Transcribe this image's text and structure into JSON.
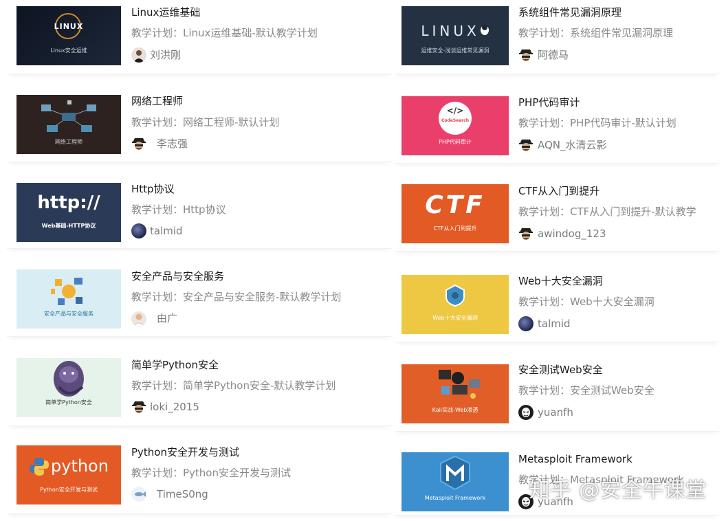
{
  "courses": [
    {
      "title": "Linux运维基础",
      "plan": "教学计划：Linux运维基础-默认教学计划",
      "author": "刘洪刚",
      "thumb_logo": "LINUX",
      "thumb_caption": "Linux安全运维"
    },
    {
      "title": "系统组件常见漏洞原理",
      "plan": "教学计划：系统组件常见漏洞原理",
      "author": "阿德马",
      "thumb_logo": "LINUX",
      "thumb_caption": "运维安全-浅谈运维常见漏洞"
    },
    {
      "title": "网络工程师",
      "plan": "教学计划：网络工程师-默认计划",
      "author": "李志强",
      "thumb_caption": "网络工程师"
    },
    {
      "title": "PHP代码审计",
      "plan": "教学计划：PHP代码审计-默认计划",
      "author": "AQN_水清云影",
      "thumb_logo": "CodeSearch",
      "thumb_caption": "PHP代码审计"
    },
    {
      "title": "Http协议",
      "plan": "教学计划：Http协议",
      "author": "talmid",
      "thumb_logo": "http://",
      "thumb_caption": "Web基础-HTTP协议"
    },
    {
      "title": "CTF从入门到提升",
      "plan": "教学计划：CTF从入门到提升-默认教学",
      "author": "awindog_123",
      "thumb_logo": "CTF",
      "thumb_caption": "CTF从入门到提升"
    },
    {
      "title": "安全产品与安全服务",
      "plan": "教学计划：安全产品与安全服务-默认教学计划",
      "author": "由广",
      "thumb_caption": "安全产品与安全服务"
    },
    {
      "title": "Web十大安全漏洞",
      "plan": "教学计划：Web十大安全漏洞",
      "author": "talmid",
      "thumb_caption": "Web十大安全漏洞"
    },
    {
      "title": "简单学Python安全",
      "plan": "教学计划：简单学Python安全-默认教学计划",
      "author": "loki_2015",
      "thumb_caption": "简单学Python安全"
    },
    {
      "title": "安全测试Web安全",
      "plan": "教学计划：安全测试Web安全",
      "author": "yuanfh",
      "thumb_caption": "Kali实战-Web渗透"
    },
    {
      "title": "Python安全开发与测试",
      "plan": "教学计划：Python安全开发与测试",
      "author": "TimeS0ng",
      "thumb_logo": "python",
      "thumb_caption": "Python安全开发与测试"
    },
    {
      "title": "Metasploit Framework",
      "plan": "教学计划：Metasploit Framework",
      "author": "yuanfh",
      "thumb_caption": "Metasploit Framework"
    }
  ],
  "watermark": "知乎 @安全牛课堂",
  "icons": {
    "hacker_avatar": "hacker-hat-icon",
    "talmid_avatar": "galaxy-avatar-icon",
    "yuanfh_avatar": "mask-avatar-icon"
  }
}
